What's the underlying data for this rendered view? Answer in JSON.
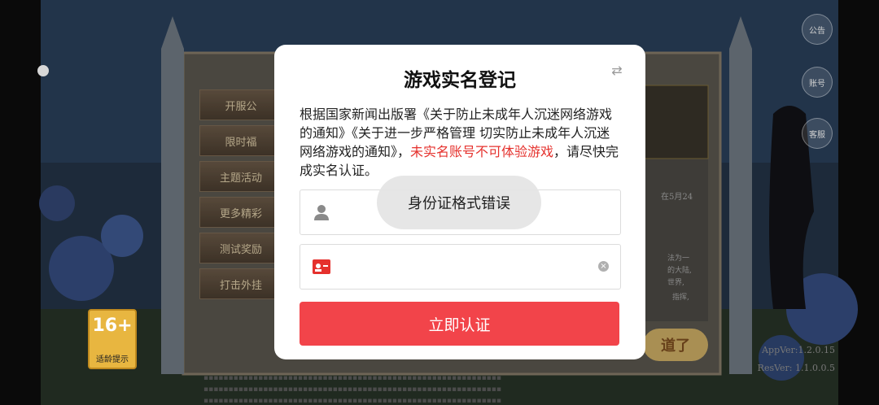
{
  "dialog": {
    "title": "游戏实名登记",
    "notice_part1": "根据国家新闻出版署《关于防止未成年人沉迷网络游戏的通知》《关于进一步严格管理 切实防止未成年人沉迷网络游戏的通知》，",
    "notice_warning": "未实名账号不可体验游戏",
    "notice_part2": "，请尽快完成实名认证。",
    "name_field_value": "",
    "id_field_value": "",
    "submit_label": "立即认证",
    "swap_icon": "swap-icon",
    "accent_color": "#f2444a",
    "warning_color": "#e5312d"
  },
  "toast": {
    "message": "身份证格式错误"
  },
  "background": {
    "side_buttons": [
      "公告",
      "账号",
      "客服"
    ],
    "menu_items": [
      "开服公",
      "限时福",
      "主题活动",
      "更多精彩",
      "测试奖励",
      "打击外挂"
    ],
    "age_rating": "16+",
    "age_tip": "适龄提示",
    "app_version": "AppVer:1.2.0.15",
    "res_version": "ResVer: 1.1.0.0.5",
    "know_button": "道了"
  }
}
